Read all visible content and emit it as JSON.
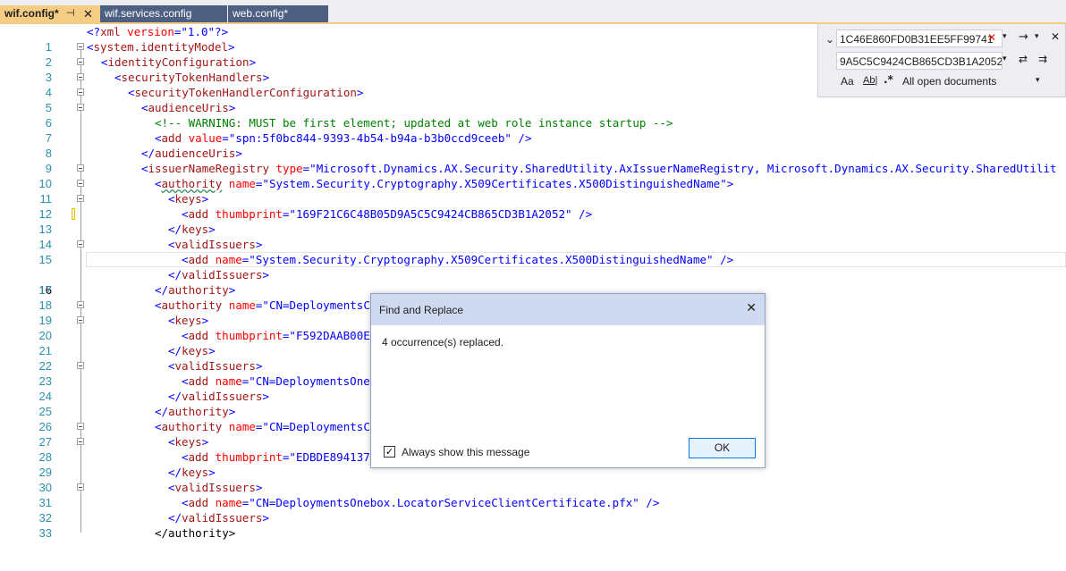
{
  "tabs": [
    {
      "label": "wif.config*",
      "pin": "⊣",
      "close": "✕"
    },
    {
      "label": "wif.services.config"
    },
    {
      "label": "web.config*"
    }
  ],
  "editor": {
    "lines": [
      {
        "n": "1",
        "html": "<span class='b'>&lt;?</span><span class='tg'>xml</span> <span class='at'>version</span><span class='b'>=\"</span><span class='b'>1.0</span><span class='b'>\"?&gt;</span>"
      },
      {
        "n": "2"
      },
      {
        "n": "3"
      },
      {
        "n": "4"
      },
      {
        "n": "5"
      },
      {
        "n": "6"
      },
      {
        "n": "7"
      },
      {
        "n": "8"
      },
      {
        "n": "9"
      },
      {
        "n": "10"
      },
      {
        "n": "11"
      },
      {
        "n": "12"
      },
      {
        "n": "13"
      },
      {
        "n": "14"
      },
      {
        "n": "15"
      },
      {
        "n": "16"
      },
      {
        "n": "17"
      },
      {
        "n": "18"
      },
      {
        "n": "19"
      },
      {
        "n": "20"
      },
      {
        "n": "21"
      },
      {
        "n": "22"
      },
      {
        "n": "23"
      },
      {
        "n": "24"
      },
      {
        "n": "25"
      },
      {
        "n": "26"
      },
      {
        "n": "27"
      },
      {
        "n": "28"
      },
      {
        "n": "29"
      },
      {
        "n": "30"
      },
      {
        "n": "31"
      },
      {
        "n": "32"
      },
      {
        "n": "33"
      }
    ],
    "text": {
      "l1_xml": "xml",
      "l1_version_attr": "version",
      "l1_version_val": "1.0",
      "system_identityModel": "system.identityModel",
      "identityConfiguration": "identityConfiguration",
      "securityTokenHandlers": "securityTokenHandlers",
      "securityTokenHandlerConfiguration": "securityTokenHandlerConfiguration",
      "audienceUris": "audienceUris",
      "comment": "<!-- WARNING: MUST be first element; updated at web role instance startup -->",
      "add": "add",
      "value_attr": "value",
      "spn_value": "spn:5f0bc844-9393-4b54-b94a-b3b0ccd9ceeb",
      "issuerNameRegistry": "issuerNameRegistry",
      "type_attr": "type",
      "type_value": "Microsoft.Dynamics.AX.Security.SharedUtility.AxIssuerNameRegistry, Microsoft.Dynamics.AX.Security.SharedUtilit",
      "authority": "authority",
      "name_attr": "name",
      "x500_name": "System.Security.Cryptography.X509Certificates.X500DistinguishedName",
      "keys": "keys",
      "thumbprint_attr": "thumbprint",
      "thumb1": "169F21C6C48B05D9A5C5C9424CB865CD3B1A2052",
      "validIssuers": "validIssuers",
      "cn_deploy_trunc": "CN=DeploymentsC",
      "thumb2_trunc": "F592DAAB00E",
      "cn_deploy_one_trunc": "CN=DeploymentsOne",
      "thumb3_trunc": "EDBDE894137",
      "cn_locator": "CN=DeploymentsOnebox.LocatorServiceClientCertificate.pfx",
      "last_partial": "</authority>"
    }
  },
  "find_widget": {
    "find_value": "1C46E860FD0B31EE5FF99741",
    "replace_value": "9A5C5C9424CB865CD3B1A2052",
    "scope": "All open documents",
    "match_case": "Aa",
    "whole_word": "Ab|",
    "regex": ".*"
  },
  "dialog": {
    "title": "Find and Replace",
    "message": "4 occurrence(s) replaced.",
    "checkbox_label": "Always show this message",
    "checkbox_checked": true,
    "ok_label": "OK"
  }
}
